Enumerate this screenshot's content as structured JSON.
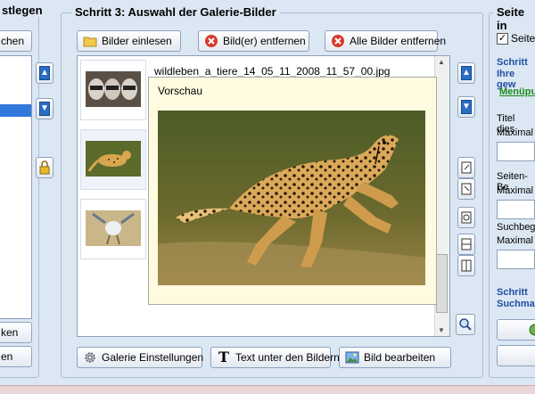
{
  "left_panel": {
    "title": "stlegen",
    "top_button": "chen",
    "bottom_button1": "ken",
    "bottom_button2": "en"
  },
  "step3": {
    "title": "Schritt 3: Auswahl der Galerie-Bilder",
    "buttons": {
      "load": "Bilder einlesen",
      "remove": "Bild(er) entfernen",
      "remove_all": "Alle Bilder entfernen",
      "gallery_settings": "Galerie Einstellungen",
      "text_under": "Text unter den Bildern",
      "edit_image": "Bild bearbeiten"
    },
    "file_name": "wildleben_a_tiere_14_05_11_2008_11_57_00.jpg",
    "preview_label": "Vorschau",
    "thumbnails": [
      {
        "name": "raccoons-thumbnail"
      },
      {
        "name": "cheetah-thumbnail"
      },
      {
        "name": "bird-thumbnail"
      }
    ]
  },
  "right_panel": {
    "title": "Seite in",
    "checkbox_label": "Seite",
    "checkbox_checked": true,
    "blue_heading1": "Schritt",
    "blue_heading2": "Ihre gew",
    "link": "Menüpu",
    "title_label": "Titel dies",
    "max1": "Maximal",
    "seiten_label": "Seiten-Be",
    "max2": "Maximal",
    "such_label": "Suchbeg",
    "max3": "Maximal",
    "step_heading1": "Schritt",
    "step_heading2": "Suchma"
  },
  "colors": {
    "background": "#dce7f4",
    "accent_blue": "#1f4fa3",
    "link_green": "#1a8a1a",
    "preview_bg": "#fffbe0"
  }
}
